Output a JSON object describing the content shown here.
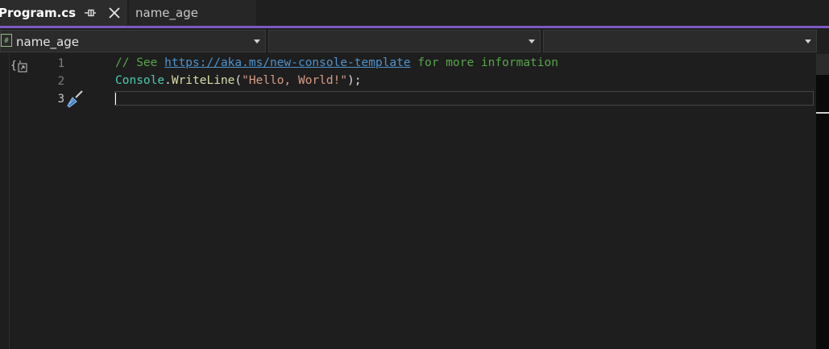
{
  "tabs": [
    {
      "label": "Program.cs",
      "active": true
    },
    {
      "label": "name_age",
      "active": false
    }
  ],
  "icons": {
    "pin": "pin-icon",
    "close": "close-icon",
    "csharp_file": "csharp-file-icon",
    "fold": "namespace-fold-icon",
    "quick_action": "quick-action-brush-icon"
  },
  "navbar": {
    "project": "name_age",
    "type_selector": "",
    "member_selector": ""
  },
  "editor": {
    "line_numbers": [
      "1",
      "2",
      "3"
    ],
    "current_line": 3,
    "line1": {
      "comment_prefix": "// See ",
      "link": "https://aka.ms/new-console-template",
      "comment_suffix": " for more information"
    },
    "line2": {
      "type": "Console",
      "dot": ".",
      "method": "WriteLine",
      "open": "(",
      "string": "\"Hello, World!\"",
      "close": ");"
    },
    "line3": ""
  },
  "colors": {
    "accent": "#7e57c2",
    "background": "#1e1e1e",
    "comment": "#57a64a",
    "link": "#4e94ce",
    "type": "#4ec9b0",
    "method": "#dcdcaa",
    "string": "#d69d85"
  }
}
